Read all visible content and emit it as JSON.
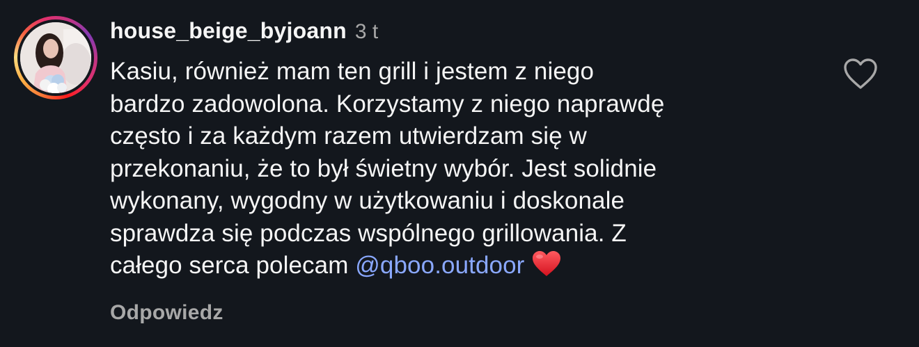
{
  "comment": {
    "username": "house_beige_byjoann",
    "timestamp": "3 t",
    "text_lines": [
      "Kasiu, również mam ten grill i jestem z niego",
      "bardzo zadowolona. Korzystamy z niego naprawdę",
      "często i za każdym razem utwierdzam się w",
      "przekonaniu, że to był świetny wybór. Jest solidnie",
      "wykonany, wygodny w użytkowaniu i doskonale",
      "sprawdza się podczas wspólnego grillowania. Z"
    ],
    "last_line_prefix": "całego serca polecam ",
    "mention": "@qboo.outdoor",
    "emoji": "red-heart-emoji",
    "reply_label": "Odpowiedz",
    "like_icon": "heart-outline-icon"
  },
  "colors": {
    "background": "#13171d",
    "text": "#f5f5f5",
    "secondary_text": "#a8a8a8",
    "mention": "#8aa8ff",
    "emoji_heart": "#e0242f"
  }
}
